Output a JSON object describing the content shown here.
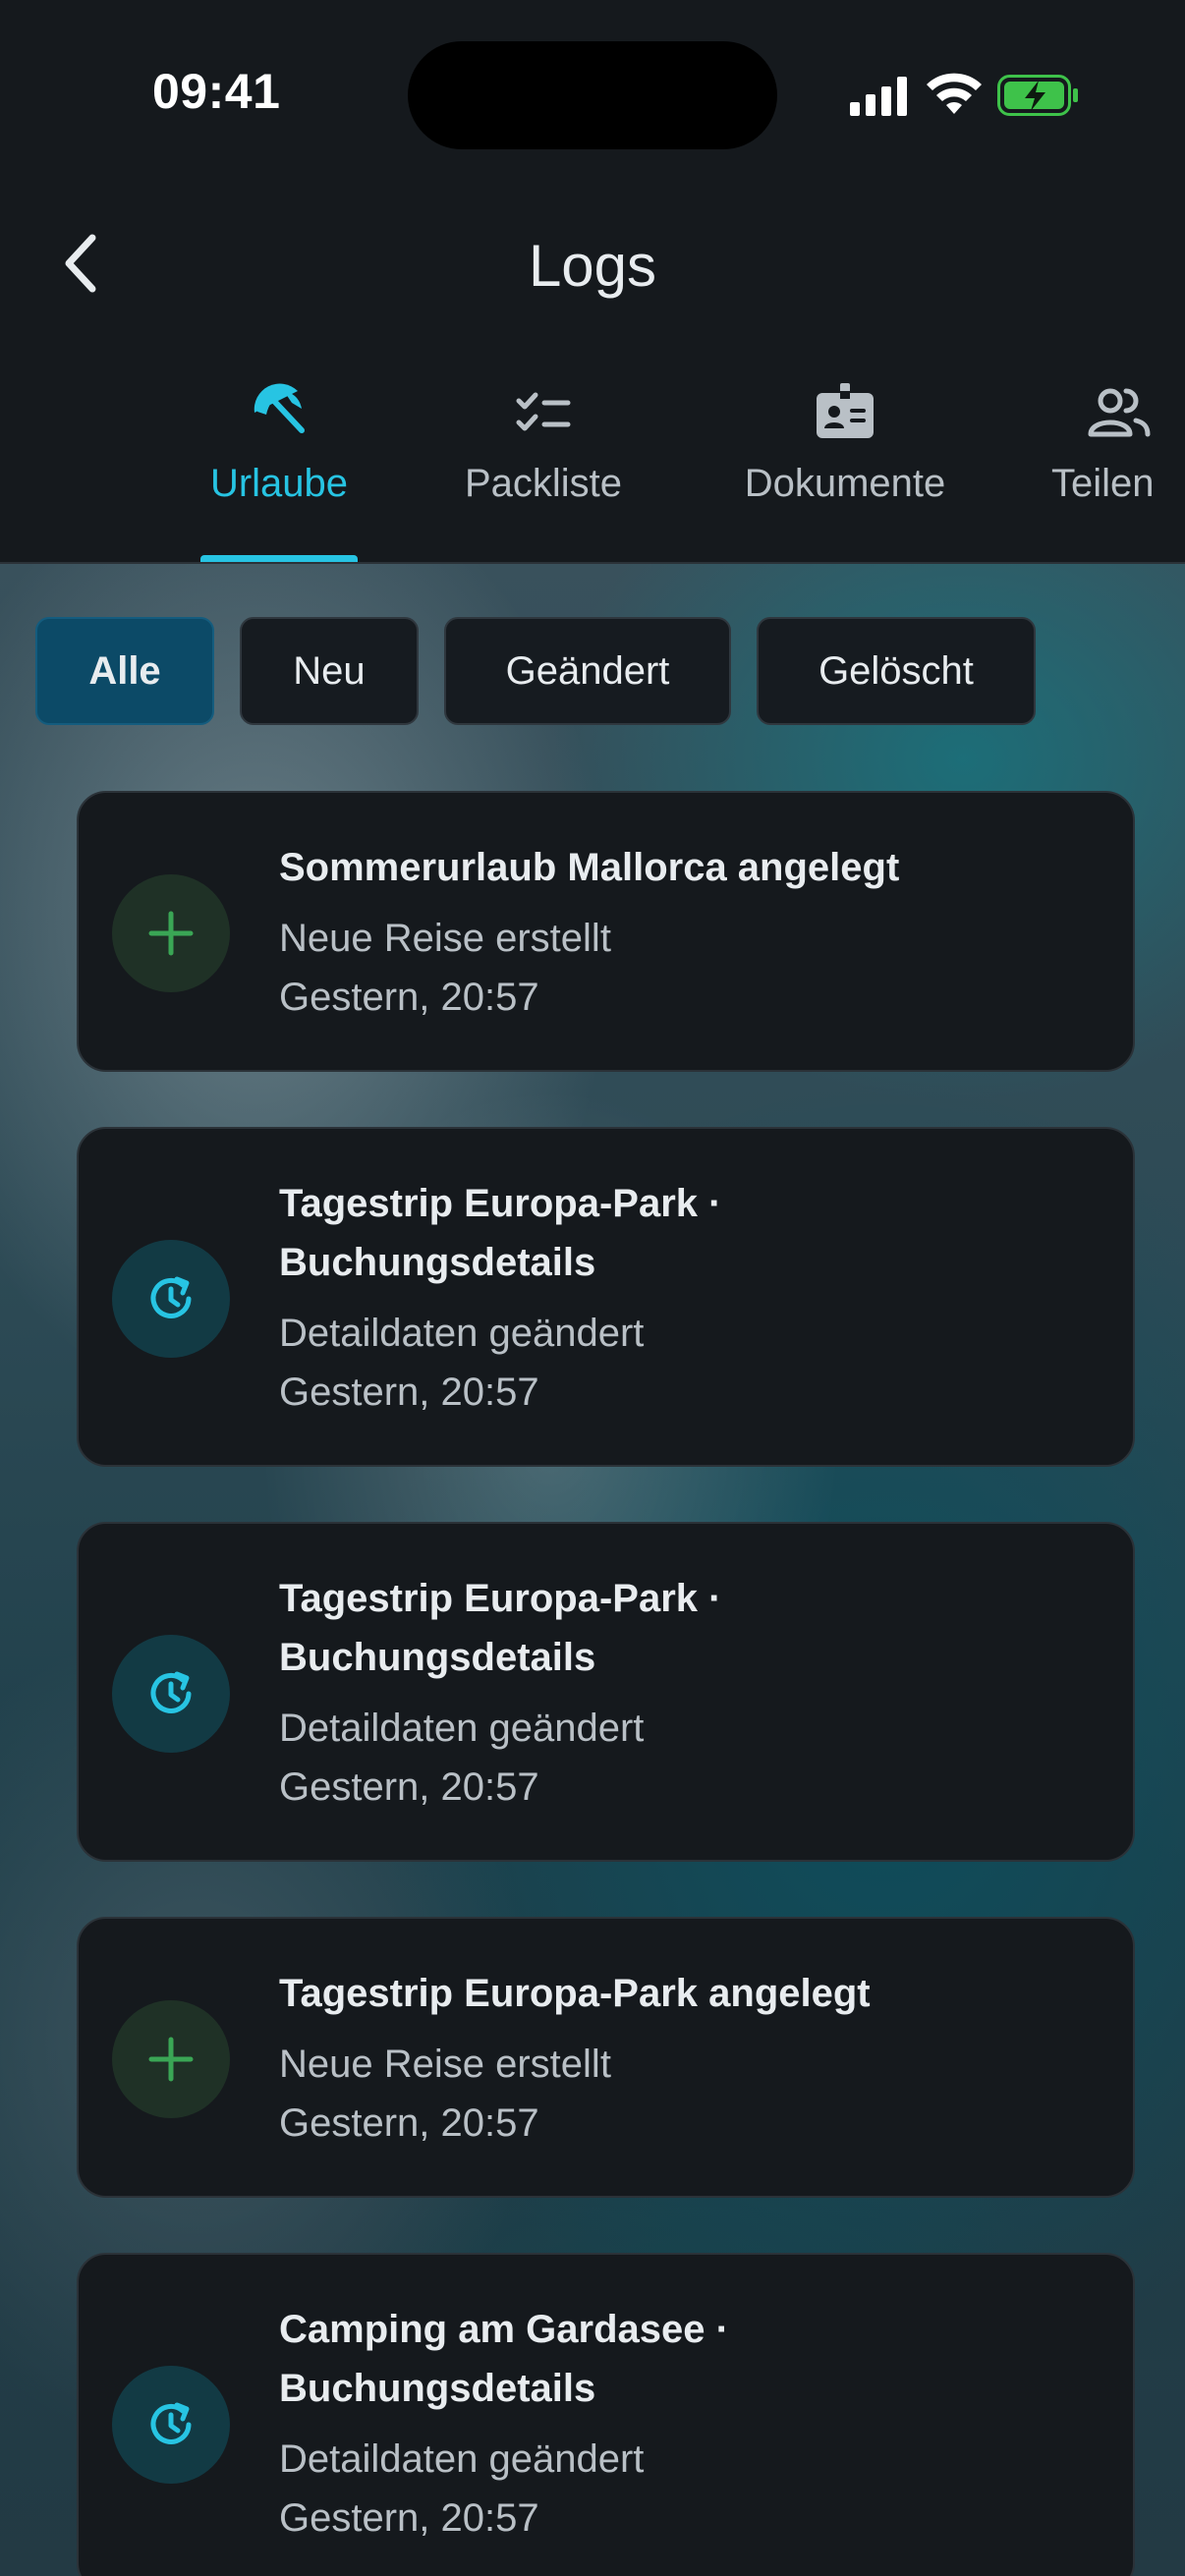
{
  "status_bar": {
    "time": "09:41"
  },
  "nav": {
    "title": "Logs",
    "back_icon": "chevron-left-icon"
  },
  "tabs": [
    {
      "label": "Urlaube",
      "icon": "beach-umbrella-icon",
      "active": true
    },
    {
      "label": "Packliste",
      "icon": "checklist-icon",
      "active": false
    },
    {
      "label": "Dokumente",
      "icon": "id-badge-icon",
      "active": false
    },
    {
      "label": "Teilen",
      "icon": "people-icon",
      "active": false
    }
  ],
  "filters": [
    {
      "label": "Alle",
      "active": true
    },
    {
      "label": "Neu",
      "active": false
    },
    {
      "label": "Geändert",
      "active": false
    },
    {
      "label": "Gelöscht",
      "active": false
    }
  ],
  "logs": [
    {
      "type": "added",
      "icon": "plus-icon",
      "title": "Sommerurlaub Mallorca angelegt",
      "subtitle": "Neue Reise erstellt",
      "time": "Gestern, 20:57"
    },
    {
      "type": "changed",
      "icon": "history-icon",
      "title_line1": "Tagestrip Europa-Park ·",
      "title_line2": "Buchungsdetails",
      "subtitle": "Detaildaten geändert",
      "time": "Gestern, 20:57"
    },
    {
      "type": "changed",
      "icon": "history-icon",
      "title_line1": "Tagestrip Europa-Park ·",
      "title_line2": "Buchungsdetails",
      "subtitle": "Detaildaten geändert",
      "time": "Gestern, 20:57"
    },
    {
      "type": "added",
      "icon": "plus-icon",
      "title": "Tagestrip Europa-Park angelegt",
      "subtitle": "Neue Reise erstellt",
      "time": "Gestern, 20:57"
    },
    {
      "type": "changed",
      "icon": "history-icon",
      "title_line1": "Camping am Gardasee ·",
      "title_line2": "Buchungsdetails",
      "subtitle": "Detaildaten geändert",
      "time": "Gestern, 20:57"
    }
  ],
  "colors": {
    "accent": "#27c4e3",
    "added_icon": "#3aa655",
    "header_bg": "#15191d",
    "active_chip": "#0c4a67"
  }
}
